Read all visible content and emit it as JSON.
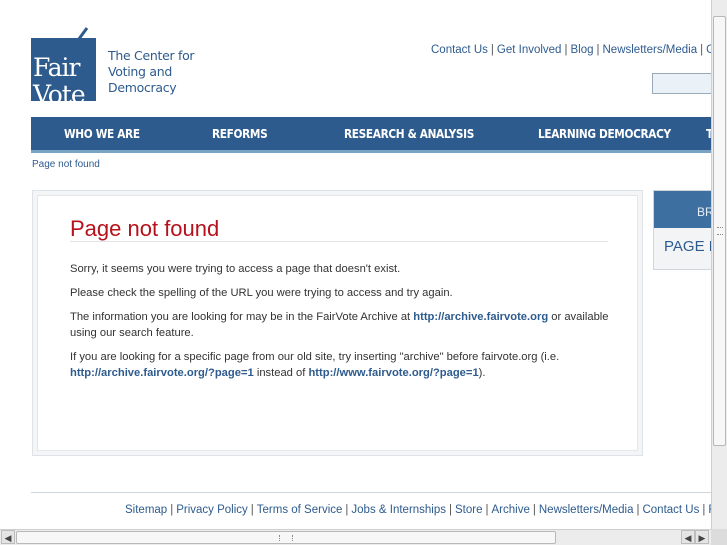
{
  "header": {
    "logo_text_line1": "Fair",
    "logo_text_line2": "Vote",
    "org_line1": "The Center for",
    "org_line2": "Voting and",
    "org_line3": "Democracy",
    "top_links": [
      "Contact Us",
      "Get Involved",
      "Blog",
      "Newsletters/Media",
      "Gl"
    ],
    "search_placeholder": ""
  },
  "nav": {
    "items": [
      "WHO WE ARE",
      "REFORMS",
      "RESEARCH & ANALYSIS",
      "LEARNING DEMOCRACY",
      "T"
    ]
  },
  "breadcrumb": "Page not found",
  "main": {
    "title": "Page not found",
    "p1": "Sorry, it seems you were trying to access a page that doesn't exist.",
    "p2": "Please check the spelling of the URL you were trying to access and try again.",
    "p3_pre": "The information you are looking for may be in the FairVote Archive at ",
    "p3_link": "http://archive.fairvote.org",
    "p3_post": " or available using our search feature.",
    "p4_pre": "If you are looking for a specific page from our old site, try inserting \"archive\" before fairvote.org (i.e. ",
    "p4_link1": "http://archive.fairvote.org/?page=1",
    "p4_mid": " instead of ",
    "p4_link2": "http://www.fairvote.org/?page=1",
    "p4_post": ")."
  },
  "sidebar": {
    "head": "BR",
    "body": "PAGE N"
  },
  "footer": {
    "links": [
      "Sitemap",
      "Privacy Policy",
      "Terms of Service",
      "Jobs & Internships",
      "Store",
      "Archive",
      "Newsletters/Media",
      "Contact Us",
      "RS"
    ]
  },
  "colors": {
    "brand_blue": "#2e5b8e",
    "title_red": "#b5121b"
  }
}
